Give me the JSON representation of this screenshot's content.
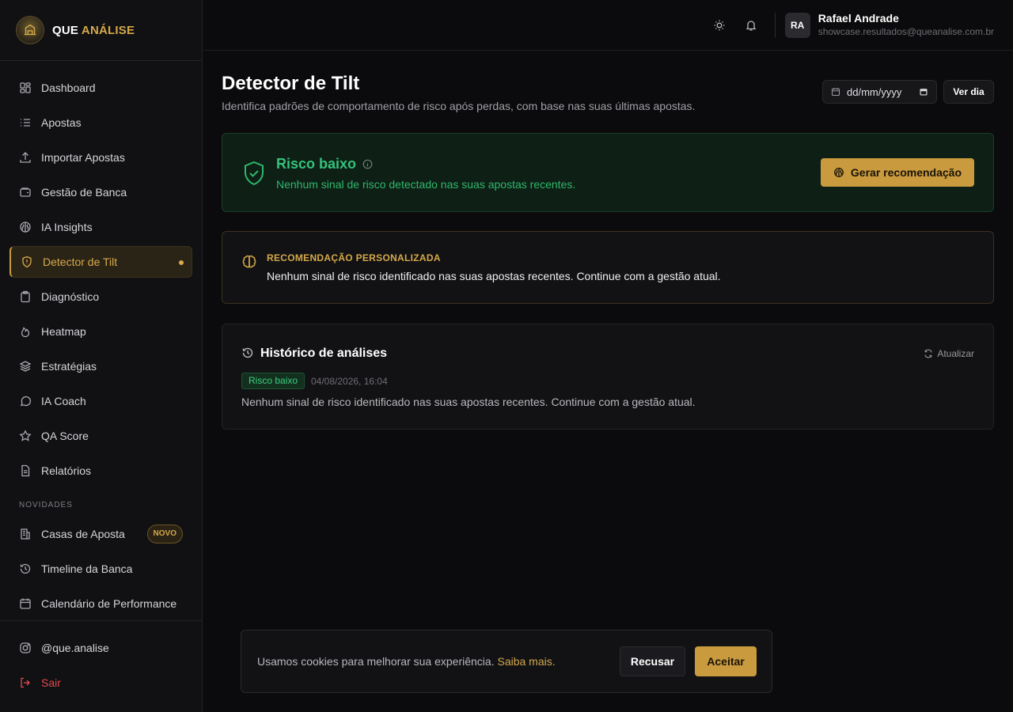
{
  "brand": {
    "name_part1": "QUE",
    "name_part2": "ANÁLISE",
    "accent_color": "#d4a84a"
  },
  "sidebar": {
    "items": [
      {
        "label": "Dashboard",
        "icon": "dashboard-icon"
      },
      {
        "label": "Apostas",
        "icon": "list-icon"
      },
      {
        "label": "Importar Apostas",
        "icon": "upload-icon"
      },
      {
        "label": "Gestão de Banca",
        "icon": "wallet-icon"
      },
      {
        "label": "IA Insights",
        "icon": "brain-icon"
      },
      {
        "label": "Detector de Tilt",
        "icon": "shield-alert-icon",
        "active": true
      },
      {
        "label": "Diagnóstico",
        "icon": "clipboard-icon"
      },
      {
        "label": "Heatmap",
        "icon": "flame-icon"
      },
      {
        "label": "Estratégias",
        "icon": "layers-icon"
      },
      {
        "label": "IA Coach",
        "icon": "chat-icon"
      },
      {
        "label": "QA Score",
        "icon": "star-icon"
      },
      {
        "label": "Relatórios",
        "icon": "file-icon"
      }
    ],
    "section_novidades": "NOVIDADES",
    "novidades": [
      {
        "label": "Casas de Aposta",
        "icon": "building-icon",
        "badge": "NOVO"
      },
      {
        "label": "Timeline da Banca",
        "icon": "history-icon"
      },
      {
        "label": "Calendário de Performance",
        "icon": "calendar-icon"
      }
    ],
    "bottom": [
      {
        "label": "@que.analise",
        "icon": "instagram-icon"
      },
      {
        "label": "Sair",
        "icon": "logout-icon"
      }
    ]
  },
  "header": {
    "user_initials": "RA",
    "user_name": "Rafael Andrade",
    "user_email": "showcase.resultados@queanalise.com.br"
  },
  "page": {
    "title": "Detector de Tilt",
    "subtitle": "Identifica padrões de comportamento de risco após perdas, com base nas suas últimas apostas.",
    "date_placeholder": "dd/mm/yyyy",
    "ver_dia_label": "Ver dia"
  },
  "risk": {
    "title": "Risco baixo",
    "subtitle": "Nenhum sinal de risco detectado nas suas apostas recentes.",
    "button_label": "Gerar recomendação",
    "status_color": "#34c27a"
  },
  "recommendation": {
    "label": "RECOMENDAÇÃO PERSONALIZADA",
    "text": "Nenhum sinal de risco identificado nas suas apostas recentes. Continue com a gestão atual."
  },
  "history": {
    "title": "Histórico de análises",
    "refresh_label": "Atualizar",
    "entries": [
      {
        "badge": "Risco baixo",
        "date": "04/08/2026, 16:04",
        "text": "Nenhum sinal de risco identificado nas suas apostas recentes. Continue com a gestão atual."
      }
    ]
  },
  "cookie": {
    "text": "Usamos cookies para melhorar sua experiência.",
    "link": "Saiba mais.",
    "decline": "Recusar",
    "accept": "Aceitar"
  }
}
